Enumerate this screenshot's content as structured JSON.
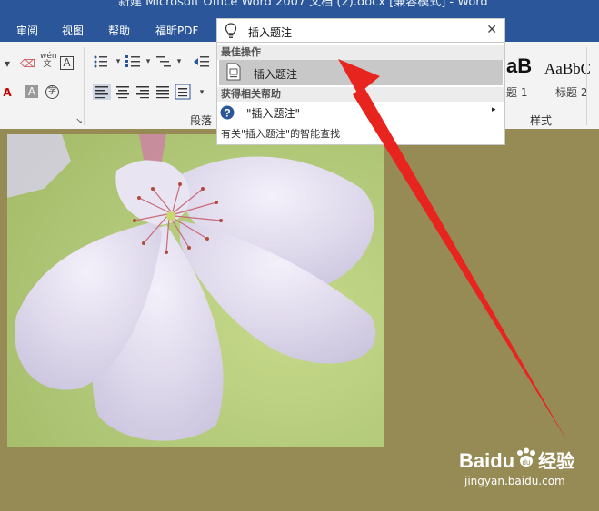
{
  "window": {
    "title": "新建 Microsoft Office Word 2007 文档 (2).docx [兼容模式] - Word"
  },
  "menu": {
    "items": [
      {
        "label": "审阅"
      },
      {
        "label": "视图"
      },
      {
        "label": "帮助"
      },
      {
        "label": "福昕PDF"
      }
    ]
  },
  "ribbon": {
    "paragraph_group_label": "段落",
    "styles_group_label": "样式",
    "style_samples": [
      {
        "preview": "aB",
        "caption": "题 1"
      },
      {
        "preview": "AaBbC",
        "caption": "标题 2"
      }
    ],
    "font_icons": {
      "pinyin": "wén\n文",
      "char_border": "A",
      "char_shading": "A",
      "enclose": "字"
    }
  },
  "tell_me": {
    "query": "插入题注",
    "best_action_header": "最佳操作",
    "best_action_label": "插入题注",
    "help_header": "获得相关帮助",
    "help_item_label": "\"插入题注\"",
    "smart_lookup_label": "有关\"插入题注\"的智能查找"
  },
  "watermark": {
    "brand": "Baidu",
    "brand_cn": "经验",
    "url": "jingyan.baidu.com"
  },
  "colors": {
    "title_bar": "#2b579a",
    "ribbon_bg": "#f3f3f3",
    "doc_bg": "#968a55",
    "arrow": "#e8241f"
  }
}
